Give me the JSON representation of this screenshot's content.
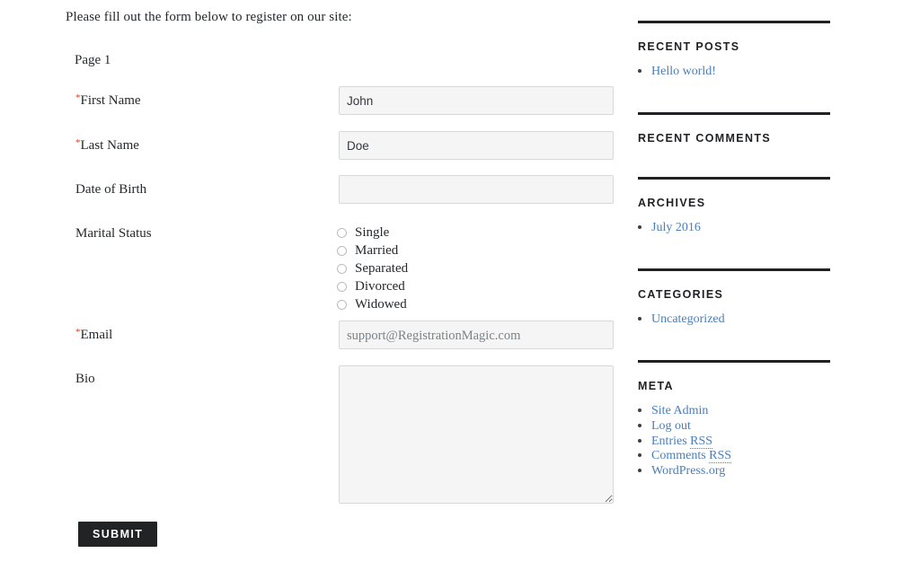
{
  "form": {
    "intro": "Please fill out the form below to register on our site:",
    "page_label": "Page 1",
    "required_marker": "*",
    "fields": [
      {
        "label": "First Name",
        "required": true,
        "type": "text",
        "value": "John",
        "placeholder": ""
      },
      {
        "label": "Last Name",
        "required": true,
        "type": "text",
        "value": "Doe",
        "placeholder": ""
      },
      {
        "label": "Date of Birth",
        "required": false,
        "type": "text",
        "value": "",
        "placeholder": ""
      },
      {
        "label": "Marital Status",
        "required": false,
        "type": "radio",
        "options": [
          "Single",
          "Married",
          "Separated",
          "Divorced",
          "Widowed"
        ],
        "selected": ""
      },
      {
        "label": "Email",
        "required": true,
        "type": "text",
        "value": "",
        "placeholder": "support@RegistrationMagic.com"
      },
      {
        "label": "Bio",
        "required": false,
        "type": "textarea",
        "value": "",
        "placeholder": ""
      }
    ],
    "submit_label": "Submit"
  },
  "sidebar": {
    "widgets": [
      {
        "title": "Recent Posts",
        "items": [
          {
            "label": "Hello world!"
          }
        ]
      },
      {
        "title": "Recent Comments",
        "items": []
      },
      {
        "title": "Archives",
        "items": [
          {
            "label": "July 2016"
          }
        ]
      },
      {
        "title": "Categories",
        "items": [
          {
            "label": "Uncategorized"
          }
        ]
      },
      {
        "title": "Meta",
        "items": [
          {
            "label": "Site Admin"
          },
          {
            "label": "Log out"
          },
          {
            "label": "Entries RSS",
            "abbr": "RSS"
          },
          {
            "label": "Comments RSS",
            "abbr": "RSS"
          },
          {
            "label": "WordPress.org"
          }
        ]
      }
    ]
  },
  "colors": {
    "link": "#4a7ebb",
    "required": "#e2401c",
    "rule": "#1f2124",
    "submit_bg": "#222325",
    "input_bg": "#f5f5f5",
    "input_border": "#d8d8d8"
  }
}
